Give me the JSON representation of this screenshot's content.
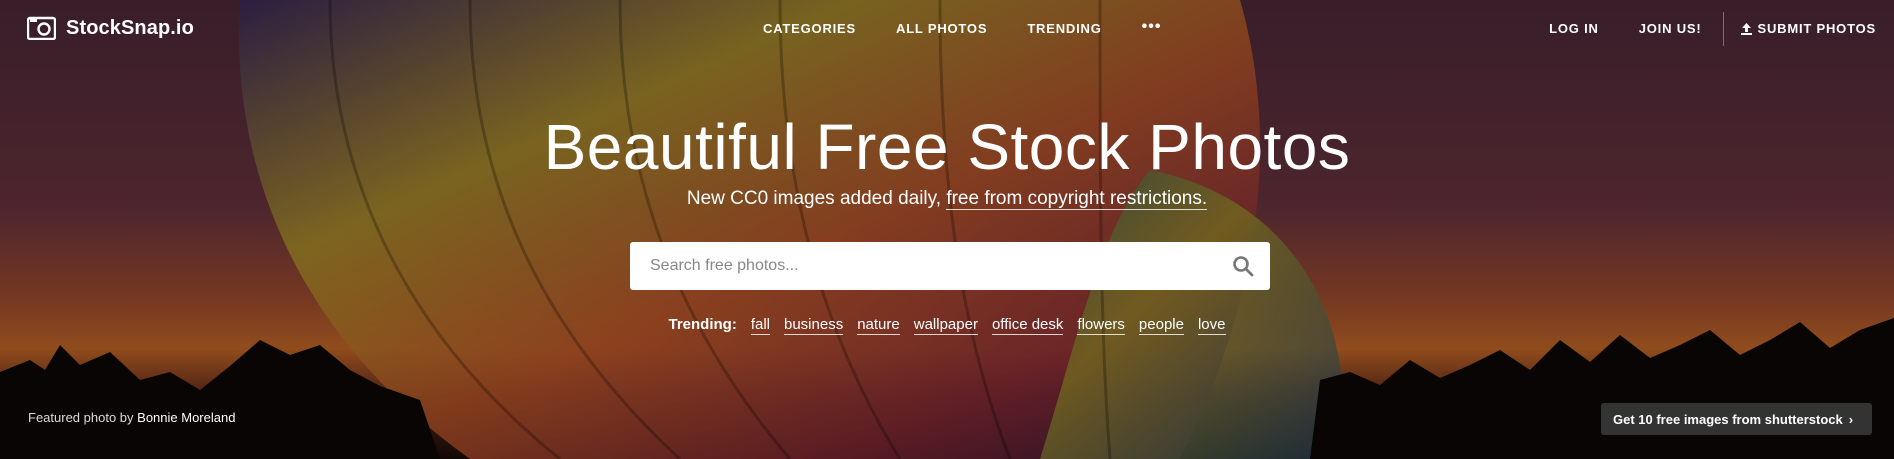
{
  "brand": {
    "name": "StockSnap.io"
  },
  "nav": {
    "center": [
      "CATEGORIES",
      "ALL PHOTOS",
      "TRENDING"
    ],
    "more": "•••",
    "right": {
      "login": "LOG IN",
      "join": "JOIN US!",
      "submit": "SUBMIT PHOTOS"
    }
  },
  "hero": {
    "headline": "Beautiful Free Stock Photos",
    "subline_prefix": "New CC0 images added daily, ",
    "subline_link": "free from copyright restrictions."
  },
  "search": {
    "placeholder": "Search free photos...",
    "value": ""
  },
  "trending": {
    "label": "Trending:",
    "tags": [
      "fall",
      "business",
      "nature",
      "wallpaper",
      "office desk",
      "flowers",
      "people",
      "love"
    ]
  },
  "credit": {
    "prefix": "Featured photo by",
    "author": "Bonnie Moreland"
  },
  "promo": {
    "label": "Get 10 free images from shutterstock",
    "chevron": "›"
  },
  "icons": [
    "camera-logo-icon",
    "upload-icon",
    "search-icon",
    "chevron-right-icon"
  ]
}
